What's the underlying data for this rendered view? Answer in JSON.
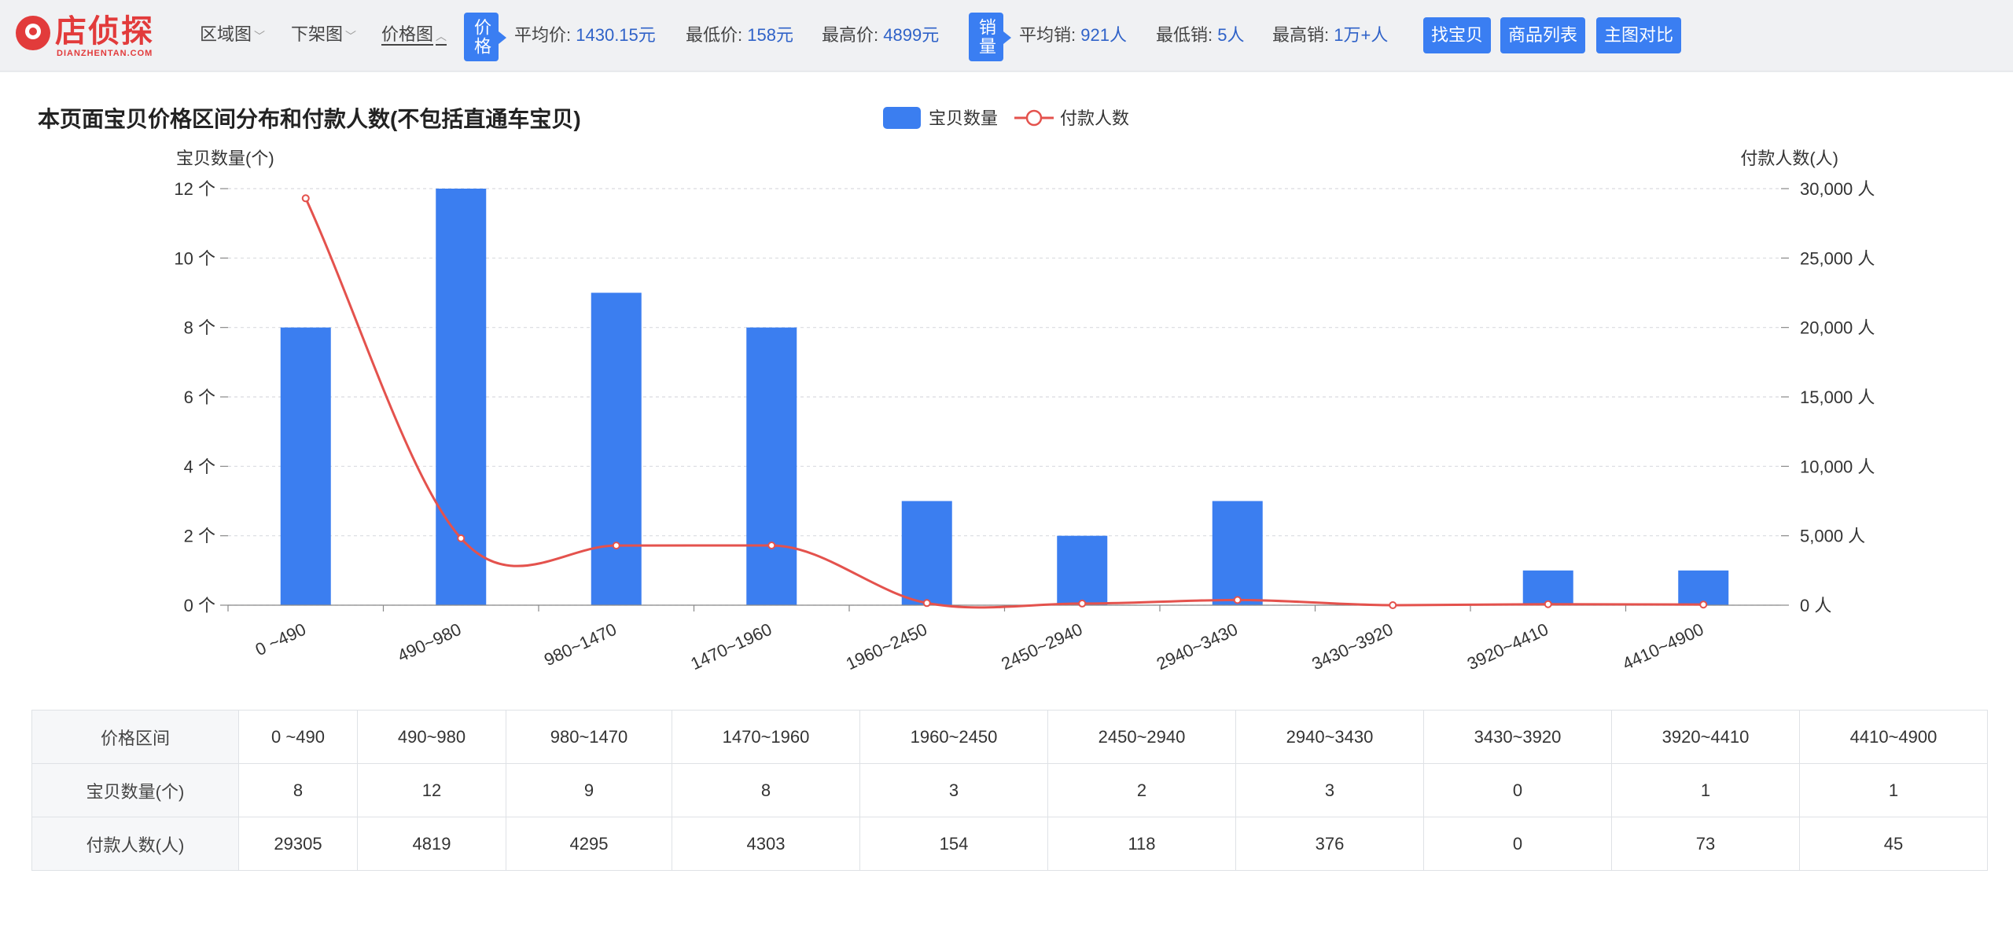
{
  "brand": {
    "name_cn": "店侦探",
    "name_en": "DIANZHENTAN.COM"
  },
  "nav": [
    {
      "label": "区域图",
      "active": false
    },
    {
      "label": "下架图",
      "active": false
    },
    {
      "label": "价格图",
      "active": true
    }
  ],
  "price_tag": "价格",
  "price_stats": [
    {
      "label": "平均价:",
      "value": "1430.15元"
    },
    {
      "label": "最低价:",
      "value": "158元"
    },
    {
      "label": "最高价:",
      "value": "4899元"
    }
  ],
  "sales_tag": "销量",
  "sales_stats": [
    {
      "label": "平均销:",
      "value": "921人"
    },
    {
      "label": "最低销:",
      "value": "5人"
    },
    {
      "label": "最高销:",
      "value": "1万+人"
    }
  ],
  "buttons": [
    "找宝贝",
    "商品列表",
    "主图对比"
  ],
  "colors": {
    "bar": "#3b7ef0",
    "line": "#e4524d",
    "accent": "#3a7ef2"
  },
  "chart_data": {
    "type": "bar",
    "title": "本页面宝贝价格区间分布和付款人数(不包括直通车宝贝)",
    "categories": [
      "0 ~490",
      "490~980",
      "980~1470",
      "1470~1960",
      "1960~2450",
      "2450~2940",
      "2940~3430",
      "3430~3920",
      "3920~4410",
      "4410~4900"
    ],
    "series": [
      {
        "name": "宝贝数量",
        "type": "bar",
        "axis": "left",
        "values": [
          8,
          12,
          9,
          8,
          3,
          2,
          3,
          0,
          1,
          1
        ]
      },
      {
        "name": "付款人数",
        "type": "line",
        "axis": "right",
        "smooth": true,
        "values": [
          29305,
          4819,
          4295,
          4303,
          154,
          118,
          376,
          0,
          73,
          45
        ]
      }
    ],
    "y_left": {
      "label": "宝贝数量(个)",
      "ylim": [
        0,
        12
      ],
      "ticks": [
        0,
        2,
        4,
        6,
        8,
        10,
        12
      ],
      "tick_labels": [
        "0 个",
        "2 个",
        "4 个",
        "6 个",
        "8 个",
        "10 个",
        "12 个"
      ]
    },
    "y_right": {
      "label": "付款人数(人)",
      "ylim": [
        0,
        30000
      ],
      "ticks": [
        0,
        5000,
        10000,
        15000,
        20000,
        25000,
        30000
      ],
      "tick_labels": [
        "0 人",
        "5,000 人",
        "10,000 人",
        "15,000 人",
        "20,000 人",
        "25,000 人",
        "30,000 人"
      ]
    },
    "grid": true,
    "legend": "top-center"
  },
  "table": {
    "row_headers": [
      "价格区间",
      "宝贝数量(个)",
      "付款人数(人)"
    ],
    "ranges": [
      "0 ~490",
      "490~980",
      "980~1470",
      "1470~1960",
      "1960~2450",
      "2450~2940",
      "2940~3430",
      "3430~3920",
      "3920~4410",
      "4410~4900"
    ],
    "counts": [
      "8",
      "12",
      "9",
      "8",
      "3",
      "2",
      "3",
      "0",
      "1",
      "1"
    ],
    "payers": [
      "29305",
      "4819",
      "4295",
      "4303",
      "154",
      "118",
      "376",
      "0",
      "73",
      "45"
    ]
  }
}
